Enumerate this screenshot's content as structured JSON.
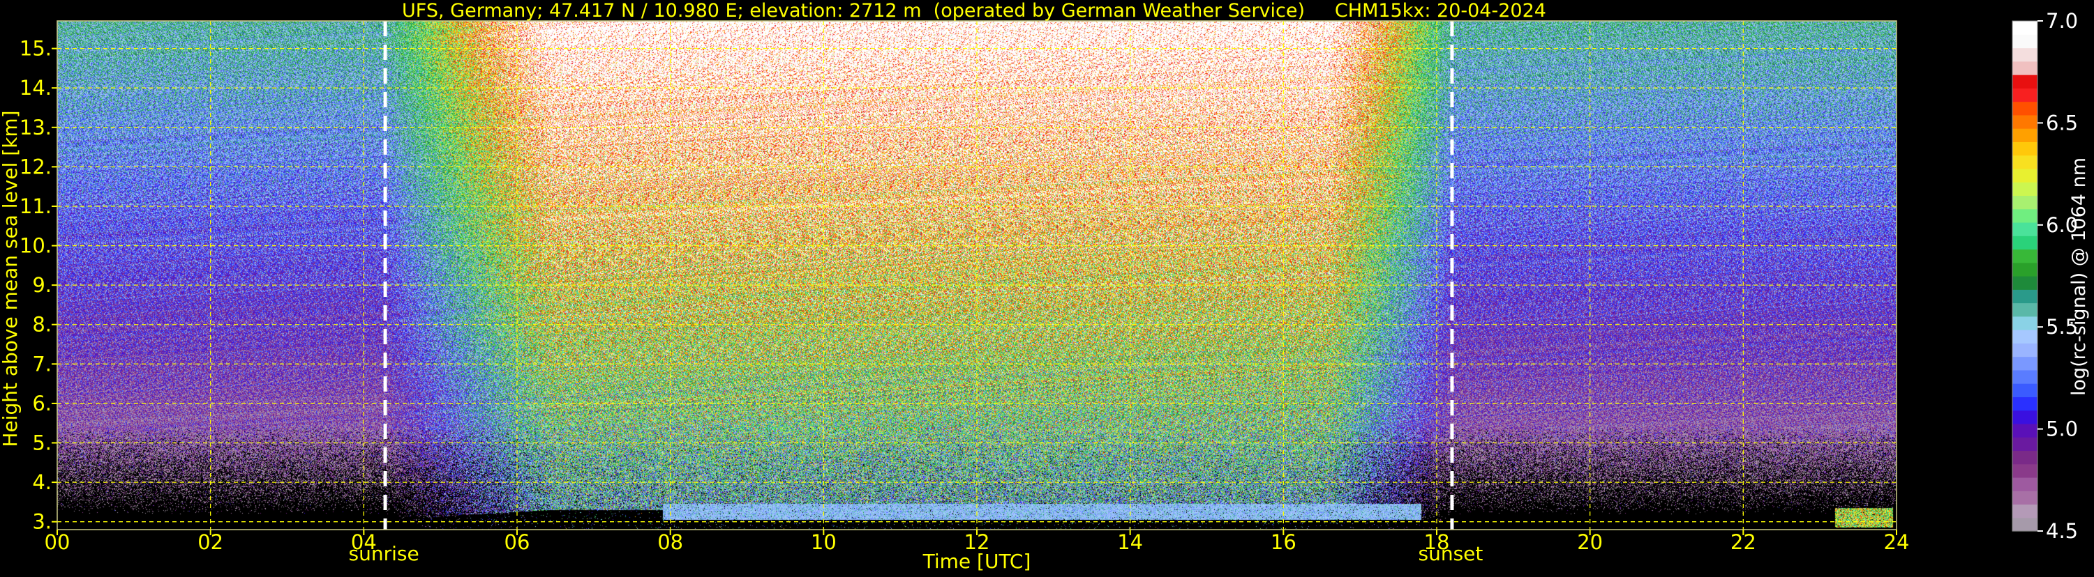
{
  "chart_data": {
    "type": "heatmap",
    "title": "UFS, Germany; 47.417 N / 10.980 E; elevation: 2712 m  (operated by German Weather Service)     CHM15kx: 20-04-2024",
    "xlabel": "Time [UTC]",
    "ylabel": "Height above mean sea level [km]",
    "xlim": [
      0,
      24
    ],
    "ylim": [
      2.8,
      15.7
    ],
    "x_ticks": [
      "00",
      "02",
      "04",
      "06",
      "08",
      "10",
      "12",
      "14",
      "16",
      "18",
      "20",
      "22",
      "24"
    ],
    "x_tick_values": [
      0,
      2,
      4,
      6,
      8,
      10,
      12,
      14,
      16,
      18,
      20,
      22,
      24
    ],
    "y_ticks": [
      "3.",
      "4.",
      "5.",
      "6.",
      "7.",
      "8.",
      "9.",
      "10.",
      "11.",
      "12.",
      "13.",
      "14.",
      "15."
    ],
    "y_tick_values": [
      3,
      4,
      5,
      6,
      7,
      8,
      9,
      10,
      11,
      12,
      13,
      14,
      15
    ],
    "grid": true,
    "events": [
      {
        "label": "sunrise",
        "time": 4.28
      },
      {
        "label": "sunset",
        "time": 18.2
      }
    ],
    "colorbar": {
      "label": "log(rc-signal) @ 1064 nm",
      "range": [
        4.5,
        7.0
      ],
      "ticks": [
        "4.5",
        "5.0",
        "5.5",
        "6.0",
        "6.5",
        "7.0"
      ],
      "tick_values": [
        4.5,
        5.0,
        5.5,
        6.0,
        6.5,
        7.0
      ],
      "colors": [
        "#a69aaa",
        "#b49ab7",
        "#a870a6",
        "#9e5aa0",
        "#8a3a8a",
        "#7a2a88",
        "#6a1aa0",
        "#5a10b8",
        "#3a10e0",
        "#2a30ff",
        "#3b5bff",
        "#5a7cff",
        "#7a98ff",
        "#9ab4ff",
        "#a6c8ff",
        "#8ad2e6",
        "#5ab8a8",
        "#2a9a8a",
        "#1e8a3a",
        "#2aa02a",
        "#38b838",
        "#2ad27a",
        "#4ae29a",
        "#70ee80",
        "#a8f070",
        "#ccf650",
        "#e8f030",
        "#f8e020",
        "#ffc80a",
        "#ffa000",
        "#ff7800",
        "#ff5000",
        "#f82020",
        "#e81010",
        "#f0c0c0",
        "#f4dede",
        "#fafafa",
        "#ffffff"
      ]
    },
    "colors": {
      "axis_text": "#ffff00",
      "grid": "#ffff00",
      "event_line": "#ffffff",
      "colorbar_text": "#ffffff",
      "background": "#000000"
    }
  }
}
